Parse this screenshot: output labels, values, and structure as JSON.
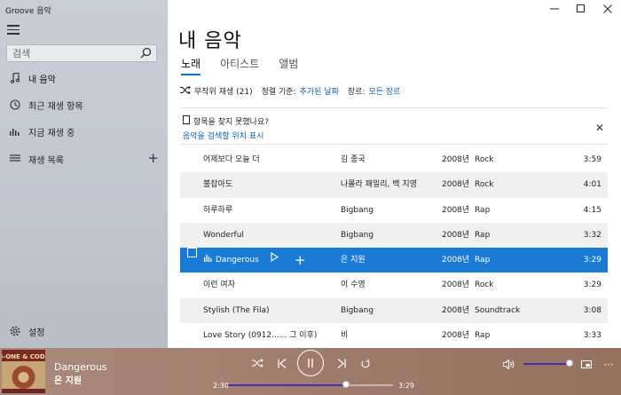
{
  "app": {
    "title": "Groove 음악"
  },
  "sidebar": {
    "search_placeholder": "검색",
    "items": [
      {
        "label": "내 음악",
        "icon": "music-note-icon"
      },
      {
        "label": "최근 재생 항목",
        "icon": "clock-icon"
      },
      {
        "label": "지금 재생 중",
        "icon": "bars-icon"
      },
      {
        "label": "재생 목록",
        "icon": "list-icon"
      }
    ],
    "settings_label": "설정"
  },
  "main": {
    "title": "내 음악",
    "tabs": [
      {
        "label": "노래",
        "active": true
      },
      {
        "label": "아티스트",
        "active": false
      },
      {
        "label": "앨범",
        "active": false
      }
    ],
    "filters": {
      "shuffle_label": "무작위 재생 (21)",
      "sort_label": "정렬 기준:",
      "sort_value": "추가된 날짜",
      "genre_label": "장르:",
      "genre_value": "모든 장르"
    },
    "notice": {
      "text": "항목을 찾지 못했나요?",
      "link": "음악을 검색할 위치 표시"
    },
    "songs": [
      {
        "title": "어제보다 오늘 더",
        "artist": "김 종국",
        "year": "2008년",
        "genre": "Rock",
        "duration": "3:59"
      },
      {
        "title": "불잡아도",
        "artist": "나몰라 패밀리, 백 지영",
        "year": "2008년",
        "genre": "Rock",
        "duration": "4:01"
      },
      {
        "title": "하루하루",
        "artist": "Bigbang",
        "year": "2008년",
        "genre": "Rap",
        "duration": "4:15"
      },
      {
        "title": "Wonderful",
        "artist": "Bigbang",
        "year": "2008년",
        "genre": "Rap",
        "duration": "3:32"
      },
      {
        "title": "Dangerous",
        "artist": "은 지원",
        "year": "2008년",
        "genre": "Rap",
        "duration": "3:29"
      },
      {
        "title": "이런 여자",
        "artist": "이 수영",
        "year": "2008년",
        "genre": "Rock",
        "duration": "3:29"
      },
      {
        "title": "Stylish (The Fila)",
        "artist": "Bigbang",
        "year": "2008년",
        "genre": "Soundtrack",
        "duration": "3:08"
      },
      {
        "title": "Love Story (0912...... 그 이후)",
        "artist": "비",
        "year": "2008년",
        "genre": "Rap",
        "duration": "3:33"
      }
    ]
  },
  "player": {
    "title": "Dangerous",
    "artist": "은 지원",
    "elapsed": "2:30",
    "total": "3:29",
    "progress": 0.717,
    "volume": 1.0,
    "album_art_text": "G-ONE & CODE"
  },
  "colors": {
    "accent": "#0078d7",
    "selected_row": "#1a7bd6",
    "player_bg": "#a27e6e",
    "slider_fill": "#4b2ab5"
  }
}
